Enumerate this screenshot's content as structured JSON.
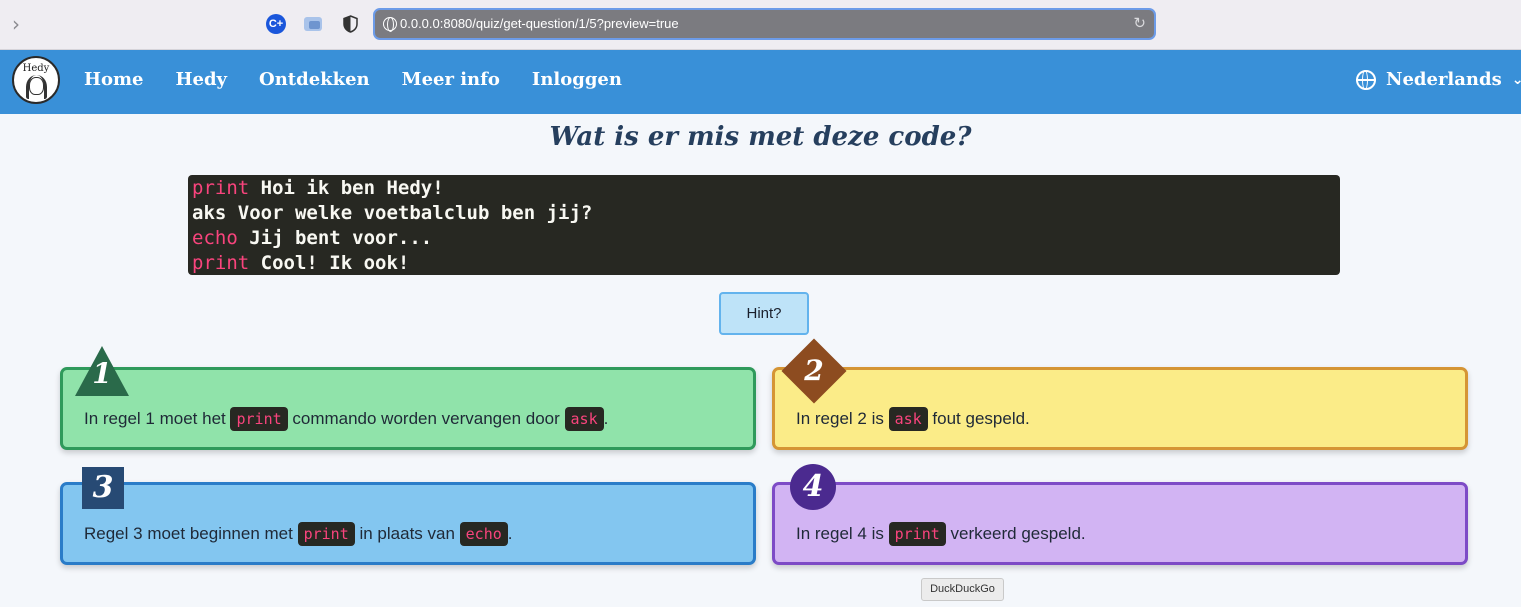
{
  "browser": {
    "url": "0.0.0.0:8080/quiz/get-question/1/5?preview=true",
    "forward_glyph": "›",
    "extension_1_label": "C+",
    "reload_glyph": "↻"
  },
  "navbar": {
    "logo_text": "Hedy",
    "links": [
      "Home",
      "Hedy",
      "Ontdekken",
      "Meer info",
      "Inloggen"
    ],
    "language": "Nederlands",
    "chevron": "⌄"
  },
  "question": {
    "title": "Wat is er mis met deze code?",
    "code_lines": [
      {
        "kw": "print",
        "rest": " Hoi ik ben Hedy!"
      },
      {
        "kw": "",
        "rest": "aks Voor welke voetbalclub ben jij?"
      },
      {
        "kw": "echo",
        "rest": " Jij bent voor..."
      },
      {
        "kw": "print",
        "rest": " Cool! Ik ook!"
      }
    ],
    "hint_label": "Hint?"
  },
  "answers": [
    {
      "number": "1",
      "pre": "In regel 1 moet het ",
      "code1": "print",
      "mid": " commando worden vervangen door ",
      "code2": "ask",
      "post": "."
    },
    {
      "number": "2",
      "pre": "In regel 2 is ",
      "code1": "ask",
      "mid": " fout gespeld.",
      "code2": "",
      "post": ""
    },
    {
      "number": "3",
      "pre": "Regel 3 moet beginnen met ",
      "code1": "print",
      "mid": " in plaats van ",
      "code2": "echo",
      "post": "."
    },
    {
      "number": "4",
      "pre": "In regel 4 is ",
      "code1": "print",
      "mid": " verkeerd gespeld.",
      "code2": "",
      "post": ""
    }
  ],
  "tooltip": "DuckDuckGo",
  "colors": {
    "navbar": "#3990d8",
    "answer_1": "#90e3aa",
    "answer_2": "#fbec88",
    "answer_3": "#83c6f0",
    "answer_4": "#d2b4f3",
    "keyword": "#f9447d"
  }
}
